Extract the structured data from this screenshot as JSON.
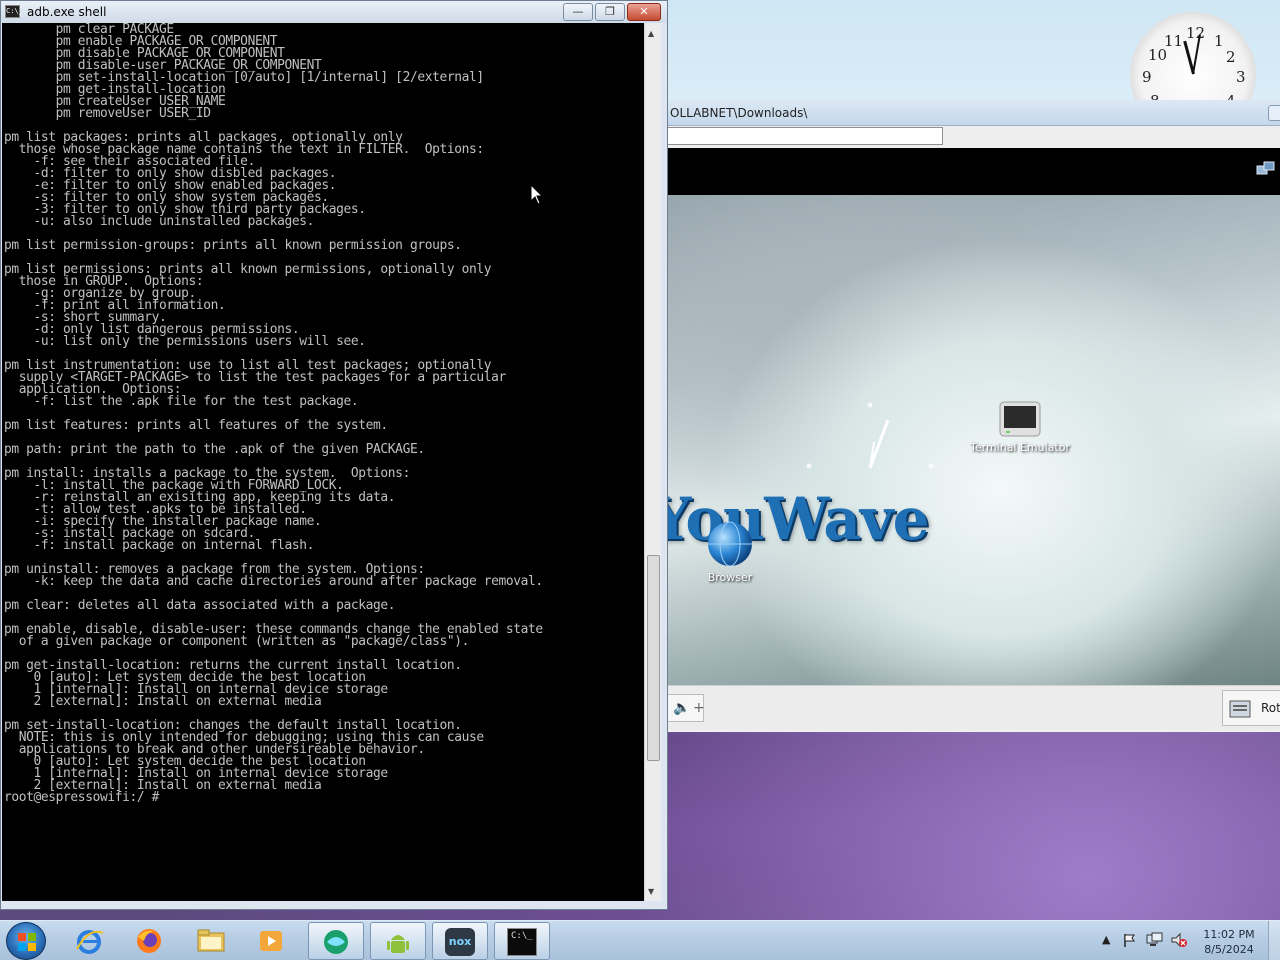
{
  "desktop": {
    "clock_gadget": {
      "numbers": [
        "12",
        "1",
        "2",
        "3",
        "4",
        "8",
        "9",
        "10",
        "11"
      ]
    }
  },
  "emulator": {
    "title": "OLLABNET\\Downloads\\",
    "android": {
      "apps": [
        {
          "label": "Terminal Emulator",
          "icon": "terminal-icon"
        },
        {
          "label": "Browser",
          "icon": "globe-icon"
        }
      ],
      "logo_text": "YouWave"
    },
    "toolbar": {
      "volume_plus": "+",
      "rotate_label": "Rot"
    }
  },
  "cmd_window": {
    "title": "adb.exe shell",
    "icon_text": "C:\\_",
    "buttons": {
      "minimize": "—",
      "maximize": "❐",
      "close": "✕"
    },
    "console_lines": [
      "       pm clear PACKAGE",
      "       pm enable PACKAGE_OR_COMPONENT",
      "       pm disable PACKAGE_OR_COMPONENT",
      "       pm disable-user PACKAGE_OR_COMPONENT",
      "       pm set-install-location [0/auto] [1/internal] [2/external]",
      "       pm get-install-location",
      "       pm createUser USER_NAME",
      "       pm removeUser USER_ID",
      "",
      "pm list packages: prints all packages, optionally only",
      "  those whose package name contains the text in FILTER.  Options:",
      "    -f: see their associated file.",
      "    -d: filter to only show disbled packages.",
      "    -e: filter to only show enabled packages.",
      "    -s: filter to only show system packages.",
      "    -3: filter to only show third party packages.",
      "    -u: also include uninstalled packages.",
      "",
      "pm list permission-groups: prints all known permission groups.",
      "",
      "pm list permissions: prints all known permissions, optionally only",
      "  those in GROUP.  Options:",
      "    -g: organize by group.",
      "    -f: print all information.",
      "    -s: short summary.",
      "    -d: only list dangerous permissions.",
      "    -u: list only the permissions users will see.",
      "",
      "pm list instrumentation: use to list all test packages; optionally",
      "  supply <TARGET-PACKAGE> to list the test packages for a particular",
      "  application.  Options:",
      "    -f: list the .apk file for the test package.",
      "",
      "pm list features: prints all features of the system.",
      "",
      "pm path: print the path to the .apk of the given PACKAGE.",
      "",
      "pm install: installs a package to the system.  Options:",
      "    -l: install the package with FORWARD_LOCK.",
      "    -r: reinstall an exisiting app, keeping its data.",
      "    -t: allow test .apks to be installed.",
      "    -i: specify the installer package name.",
      "    -s: install package on sdcard.",
      "    -f: install package on internal flash.",
      "",
      "pm uninstall: removes a package from the system. Options:",
      "    -k: keep the data and cache directories around after package removal.",
      "",
      "pm clear: deletes all data associated with a package.",
      "",
      "pm enable, disable, disable-user: these commands change the enabled state",
      "  of a given package or component (written as \"package/class\").",
      "",
      "pm get-install-location: returns the current install location.",
      "    0 [auto]: Let system decide the best location",
      "    1 [internal]: Install on internal device storage",
      "    2 [external]: Install on external media",
      "",
      "pm set-install-location: changes the default install location.",
      "  NOTE: this is only intended for debugging; using this can cause",
      "  applications to break and other undersireable behavior.",
      "    0 [auto]: Let system decide the best location",
      "    1 [internal]: Install on internal device storage",
      "    2 [external]: Install on external media",
      "root@espressowifi:/ # "
    ]
  },
  "taskbar": {
    "items": [
      {
        "name": "start-button",
        "icon": "windows-logo-icon"
      },
      {
        "name": "internet-explorer",
        "icon": "ie-icon"
      },
      {
        "name": "firefox",
        "icon": "firefox-icon"
      },
      {
        "name": "file-explorer",
        "icon": "folder-icon"
      },
      {
        "name": "media-player",
        "icon": "media-player-icon"
      },
      {
        "name": "youwave",
        "icon": "youwave-icon"
      },
      {
        "name": "android-sdk",
        "icon": "android-icon"
      },
      {
        "name": "nox",
        "icon": "nox-icon"
      },
      {
        "name": "command-prompt",
        "icon": "cmd-icon"
      }
    ],
    "nox_label": "nox",
    "cmd_label": "C:\\_",
    "tray": {
      "time": "11:02 PM",
      "date": "8/5/2024"
    }
  }
}
